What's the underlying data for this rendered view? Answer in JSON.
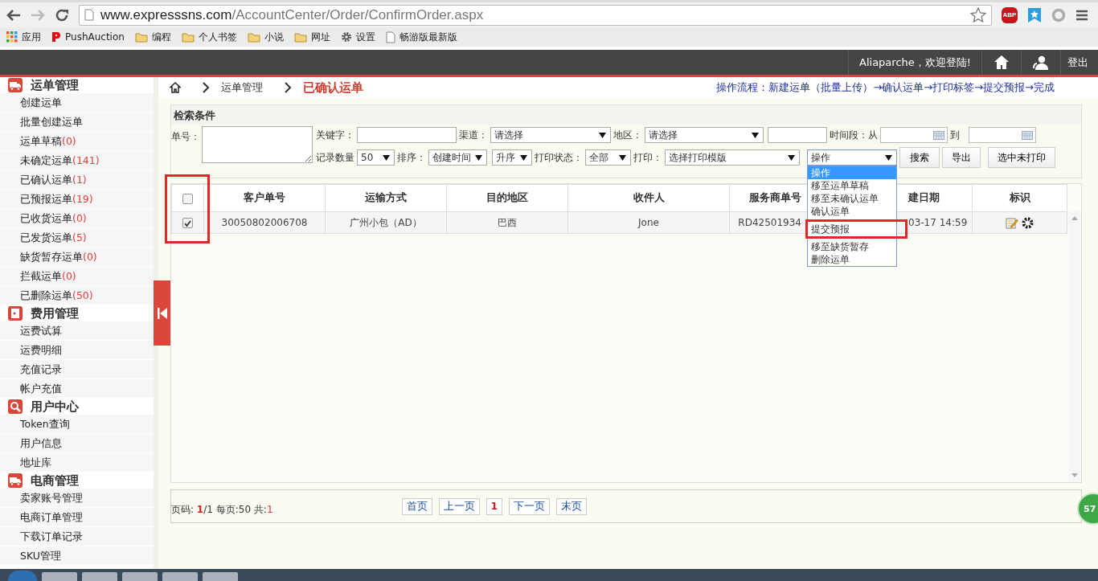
{
  "browser": {
    "url_host": "www.expresssns.com",
    "url_path": "/AccountCenter/Order/ConfirmOrder.aspx",
    "extensions": [
      {
        "kind": "abp",
        "label": "ABP"
      },
      {
        "kind": "bookmark"
      },
      {
        "kind": "circle"
      }
    ]
  },
  "bookmarks": [
    {
      "kind": "apps",
      "label": "应用"
    },
    {
      "kind": "site",
      "label": "PushAuction"
    },
    {
      "kind": "folder",
      "label": "编程"
    },
    {
      "kind": "folder",
      "label": "个人书签"
    },
    {
      "kind": "folder",
      "label": "小说"
    },
    {
      "kind": "folder",
      "label": "网址"
    },
    {
      "kind": "settings",
      "label": "设置"
    },
    {
      "kind": "page",
      "label": "畅游版最新版"
    }
  ],
  "header": {
    "greeting": "Aliaparche，欢迎登陆!",
    "logout": "登出"
  },
  "sidebar": [
    {
      "title": "运单管理",
      "kind": "truck",
      "items": [
        {
          "label": "创建运单"
        },
        {
          "label": "批量创建运单"
        },
        {
          "label": "运单草稿",
          "count": "(0)"
        },
        {
          "label": "未确定运单",
          "count": "(141)"
        },
        {
          "label": "已确认运单",
          "count": "(1)"
        },
        {
          "label": "已预报运单",
          "count": "(19)"
        },
        {
          "label": "已收货运单",
          "count": "(0)"
        },
        {
          "label": "已发货运单",
          "count": "(5)"
        },
        {
          "label": "缺货暂存运单",
          "count": "(0)"
        },
        {
          "label": "拦截运单",
          "count": "(0)"
        },
        {
          "label": "已删除运单",
          "count": "(50)"
        }
      ]
    },
    {
      "title": "费用管理",
      "kind": "safe",
      "items": [
        {
          "label": "运费试算"
        },
        {
          "label": "运费明细"
        },
        {
          "label": "充值记录"
        },
        {
          "label": "帐户充值"
        }
      ]
    },
    {
      "title": "用户中心",
      "kind": "search",
      "items": [
        {
          "label": "Token查询"
        },
        {
          "label": "用户信息"
        },
        {
          "label": "地址库"
        }
      ]
    },
    {
      "title": "电商管理",
      "kind": "truck",
      "items": [
        {
          "label": "卖家账号管理"
        },
        {
          "label": "电商订单管理"
        },
        {
          "label": "下载订单记录"
        },
        {
          "label": "SKU管理"
        }
      ]
    }
  ],
  "breadcrumb": [
    {
      "label": "运单管理",
      "current": false
    },
    {
      "label": "已确认运单",
      "current": true
    }
  ],
  "workflow": "操作流程：新建运单（批量上传）→确认运单→打印标签→提交预报→完成",
  "search": {
    "title": "检索条件",
    "order_no_label": "单号：",
    "filters_top": [
      {
        "kind": "label",
        "text": "关键字："
      },
      {
        "kind": "input"
      },
      {
        "kind": "label",
        "text": "渠道："
      },
      {
        "kind": "select",
        "value": "请选择"
      },
      {
        "kind": "label",
        "text": "地区："
      },
      {
        "kind": "select",
        "value": "请选择"
      },
      {
        "kind": "input"
      },
      {
        "kind": "label",
        "text": "时间段：从"
      },
      {
        "kind": "date"
      },
      {
        "kind": "label",
        "text": "到"
      },
      {
        "kind": "date"
      }
    ],
    "filters_bottom": [
      {
        "kind": "label",
        "text": "记录数量"
      },
      {
        "kind": "select",
        "value": "50"
      },
      {
        "kind": "label",
        "text": "排序："
      },
      {
        "kind": "select",
        "value": "创建时间"
      },
      {
        "kind": "select",
        "value": "升序"
      },
      {
        "kind": "label",
        "text": "打印状态："
      },
      {
        "kind": "select",
        "value": "全部"
      },
      {
        "kind": "label",
        "text": "打印："
      },
      {
        "kind": "select",
        "value": "选择打印模版"
      },
      {
        "kind": "select",
        "value": "操作",
        "expanded": true,
        "options": [
          {
            "label": "操作",
            "selected": true,
            "highlighted": false
          },
          {
            "label": "移至运单草稿",
            "selected": false,
            "highlighted": false
          },
          {
            "label": "移至未确认运单",
            "selected": false,
            "highlighted": false
          },
          {
            "label": "确认运单",
            "selected": false,
            "highlighted": false
          },
          {
            "label": "提交预报",
            "selected": false,
            "highlighted": true
          },
          {
            "label": "移至缺货暂存",
            "selected": false,
            "highlighted": false
          },
          {
            "label": "删除运单",
            "selected": false,
            "highlighted": false
          }
        ]
      },
      {
        "kind": "button",
        "text": "搜索"
      },
      {
        "kind": "button",
        "text": "导出"
      },
      {
        "kind": "button",
        "text": "选中未打印"
      }
    ]
  },
  "table": {
    "select_all": {
      "checked": false
    },
    "checkbox_column_highlighted": true,
    "columns": [
      "客户单号",
      "运输方式",
      "目的地区",
      "收件人",
      "服务商单号",
      "建日期",
      "标识"
    ],
    "rows": [
      {
        "selected": true,
        "cells": [
          "30050802006708",
          "广州小包（AD）",
          "巴西",
          "Jone",
          "RD42501934",
          "03-17 14:59"
        ],
        "icons": [
          {
            "kind": "edit"
          },
          {
            "kind": "gear"
          }
        ]
      }
    ]
  },
  "pager": {
    "summary": [
      {
        "kind": "plain",
        "text": "页码: "
      },
      {
        "kind": "current",
        "text": "1"
      },
      {
        "kind": "plain",
        "text": "/1 每页:50 共:"
      },
      {
        "kind": "count",
        "text": "1"
      }
    ],
    "buttons": [
      {
        "kind": "link",
        "label": "首页"
      },
      {
        "kind": "link",
        "label": "上一页"
      },
      {
        "kind": "current",
        "label": "1"
      },
      {
        "kind": "link",
        "label": "下一页"
      },
      {
        "kind": "link",
        "label": "末页"
      }
    ]
  },
  "floating_badge": "57"
}
